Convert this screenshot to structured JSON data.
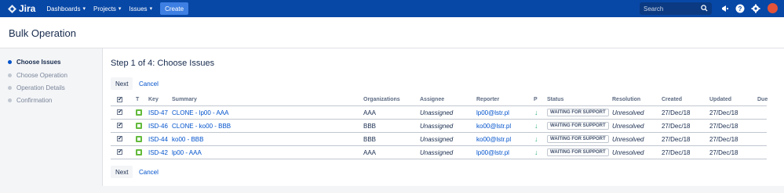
{
  "topbar": {
    "logo": "Jira",
    "nav": [
      "Dashboards",
      "Projects",
      "Issues"
    ],
    "create_label": "Create",
    "search_placeholder": "Search"
  },
  "page_title": "Bulk Operation",
  "steps": [
    {
      "label": "Choose Issues",
      "active": true
    },
    {
      "label": "Choose Operation",
      "active": false
    },
    {
      "label": "Operation Details",
      "active": false
    },
    {
      "label": "Confirmation",
      "active": false
    }
  ],
  "main": {
    "heading": "Step 1 of 4: Choose Issues",
    "next_label": "Next",
    "cancel_label": "Cancel"
  },
  "table": {
    "headers": {
      "check": "✔",
      "t": "T",
      "key": "Key",
      "summary": "Summary",
      "organizations": "Organizations",
      "assignee": "Assignee",
      "reporter": "Reporter",
      "p": "P",
      "status": "Status",
      "resolution": "Resolution",
      "created": "Created",
      "updated": "Updated",
      "due": "Due"
    },
    "rows": [
      {
        "check": "✔",
        "key": "ISD-47",
        "summary": "CLONE - lp00 - AAA",
        "organizations": "AAA",
        "assignee": "Unassigned",
        "reporter": "lp00@lstr.pl",
        "priority": "↓",
        "status": "WAITING FOR SUPPORT",
        "resolution": "Unresolved",
        "created": "27/Dec/18",
        "updated": "27/Dec/18"
      },
      {
        "check": "✔",
        "key": "ISD-46",
        "summary": "CLONE - ko00 - BBB",
        "organizations": "BBB",
        "assignee": "Unassigned",
        "reporter": "ko00@lstr.pl",
        "priority": "↓",
        "status": "WAITING FOR SUPPORT",
        "resolution": "Unresolved",
        "created": "27/Dec/18",
        "updated": "27/Dec/18"
      },
      {
        "check": "✔",
        "key": "ISD-44",
        "summary": "ko00 - BBB",
        "organizations": "BBB",
        "assignee": "Unassigned",
        "reporter": "ko00@lstr.pl",
        "priority": "↓",
        "status": "WAITING FOR SUPPORT",
        "resolution": "Unresolved",
        "created": "27/Dec/18",
        "updated": "27/Dec/18"
      },
      {
        "check": "✔",
        "key": "ISD-42",
        "summary": "lp00 - AAA",
        "organizations": "AAA",
        "assignee": "Unassigned",
        "reporter": "lp00@lstr.pl",
        "priority": "↓",
        "status": "WAITING FOR SUPPORT",
        "resolution": "Unresolved",
        "created": "27/Dec/18",
        "updated": "27/Dec/18"
      }
    ]
  },
  "colors": {
    "topbar": "#0747a6",
    "create": "#3d7fe2",
    "link": "#0052cc",
    "issue_type": "#63ba3c",
    "priority_low": "#36b37e"
  }
}
